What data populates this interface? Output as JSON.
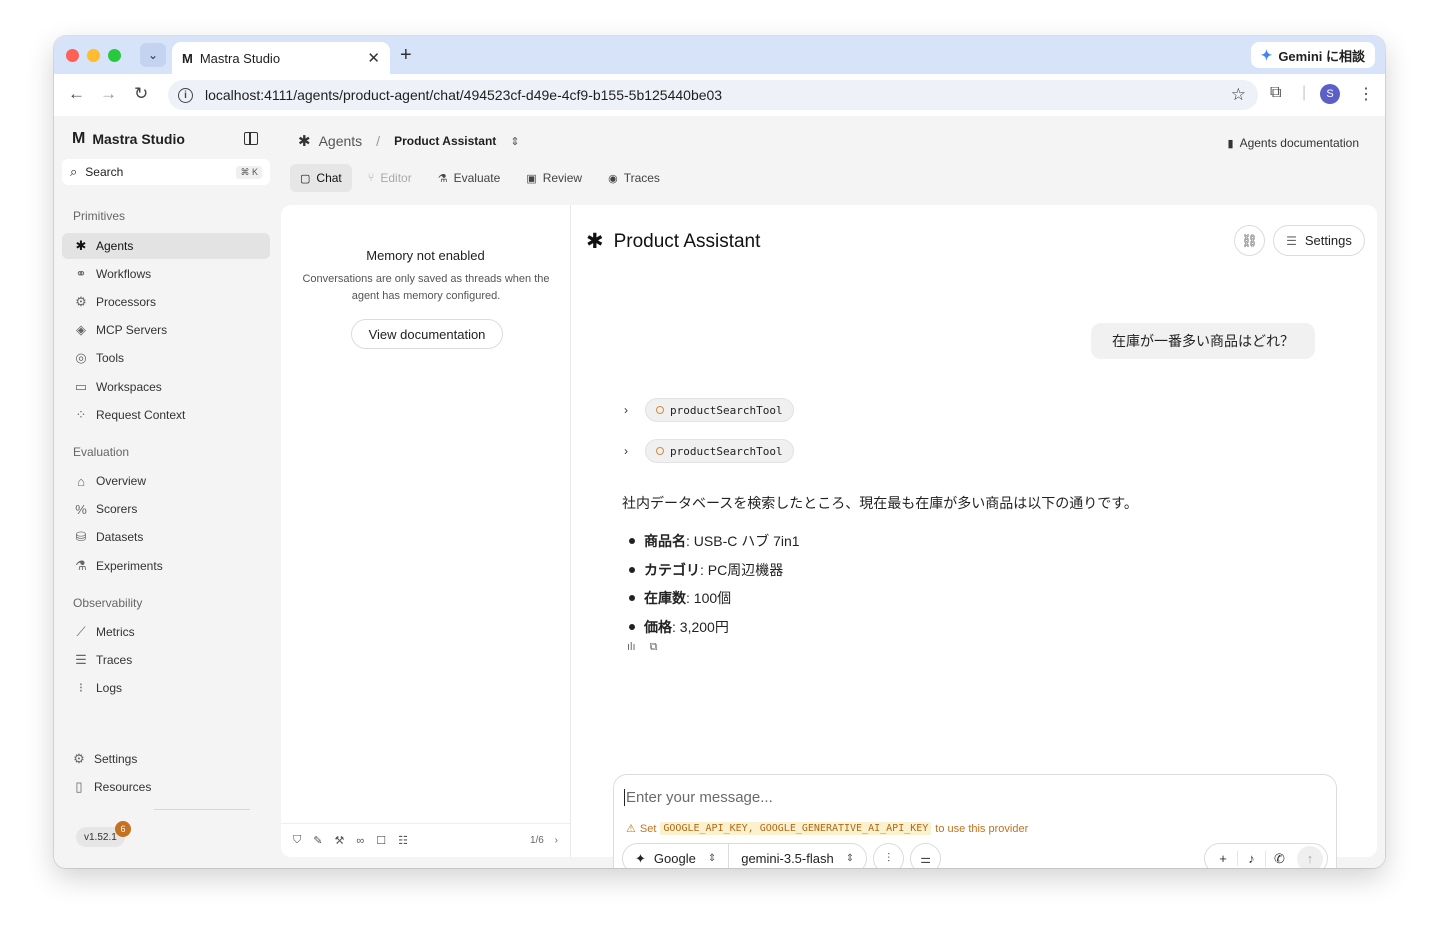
{
  "browser": {
    "tab_title": "Mastra Studio",
    "tab_logo": "M",
    "close_glyph": "✕",
    "new_tab_glyph": "+",
    "gemini_label": "Gemini に相談",
    "url": "localhost:4111/agents/product-agent/chat/494523cf-d49e-4cf9-b155-5b125440be03",
    "profile_initial": "S"
  },
  "sidebar": {
    "brand": "Mastra Studio",
    "search_label": "Search",
    "search_shortcut": "⌘ K",
    "sections": {
      "primitives": "Primitives",
      "evaluation": "Evaluation",
      "observability": "Observability"
    },
    "primitives": [
      {
        "label": "Agents",
        "icon": "agents-icon"
      },
      {
        "label": "Workflows",
        "icon": "workflows-icon"
      },
      {
        "label": "Processors",
        "icon": "processors-icon"
      },
      {
        "label": "MCP Servers",
        "icon": "mcp-icon"
      },
      {
        "label": "Tools",
        "icon": "tools-icon"
      },
      {
        "label": "Workspaces",
        "icon": "folder-icon"
      },
      {
        "label": "Request Context",
        "icon": "context-icon"
      }
    ],
    "evaluation": [
      {
        "label": "Overview",
        "icon": "home-icon"
      },
      {
        "label": "Scorers",
        "icon": "percent-icon"
      },
      {
        "label": "Datasets",
        "icon": "database-icon"
      },
      {
        "label": "Experiments",
        "icon": "flask-icon"
      }
    ],
    "observability": [
      {
        "label": "Metrics",
        "icon": "chart-icon"
      },
      {
        "label": "Traces",
        "icon": "traces-icon"
      },
      {
        "label": "Logs",
        "icon": "logs-icon"
      }
    ],
    "bottom": [
      {
        "label": "Settings",
        "icon": "gear-icon"
      },
      {
        "label": "Resources",
        "icon": "book-icon"
      }
    ],
    "version": "v1.52.1",
    "version_badge": "6"
  },
  "header": {
    "breadcrumb_root": "Agents",
    "breadcrumb_sep": "/",
    "breadcrumb_current": "Product Assistant",
    "docs_link": "Agents documentation"
  },
  "tabs": [
    {
      "label": "Chat",
      "state": "active"
    },
    {
      "label": "Editor",
      "state": "disabled"
    },
    {
      "label": "Evaluate",
      "state": "normal"
    },
    {
      "label": "Review",
      "state": "normal"
    },
    {
      "label": "Traces",
      "state": "normal"
    }
  ],
  "threads": {
    "title": "Memory not enabled",
    "description": "Conversations are only saved as threads when the agent has memory configured.",
    "button": "View documentation",
    "pager": "1/6"
  },
  "chat": {
    "title": "Product Assistant",
    "settings_label": "Settings",
    "user_message": "在庫が一番多い商品はどれ？",
    "tool_calls": [
      "productSearchTool",
      "productSearchTool"
    ],
    "response_intro": "社内データベースを検索したところ、現在最も在庫が多い商品は以下の通りです。",
    "response_items": [
      {
        "key": "商品名",
        "value": ": USB-C ハブ 7in1"
      },
      {
        "key": "カテゴリ",
        "value": ": PC周辺機器"
      },
      {
        "key": "在庫数",
        "value": ": 100個"
      },
      {
        "key": "価格",
        "value": ": 3,200円"
      }
    ]
  },
  "composer": {
    "placeholder": "Enter your message...",
    "warning_prefix": "Set",
    "warning_keys": "GOOGLE_API_KEY, GOOGLE_GENERATIVE_AI_API_KEY",
    "warning_suffix": "to use this provider",
    "provider": "Google",
    "model": "gemini-3.5-flash"
  },
  "colors": {
    "accent_warning": "#c2721d",
    "tab_strip": "#d7e3f9",
    "version_badge": "#c5711e"
  }
}
